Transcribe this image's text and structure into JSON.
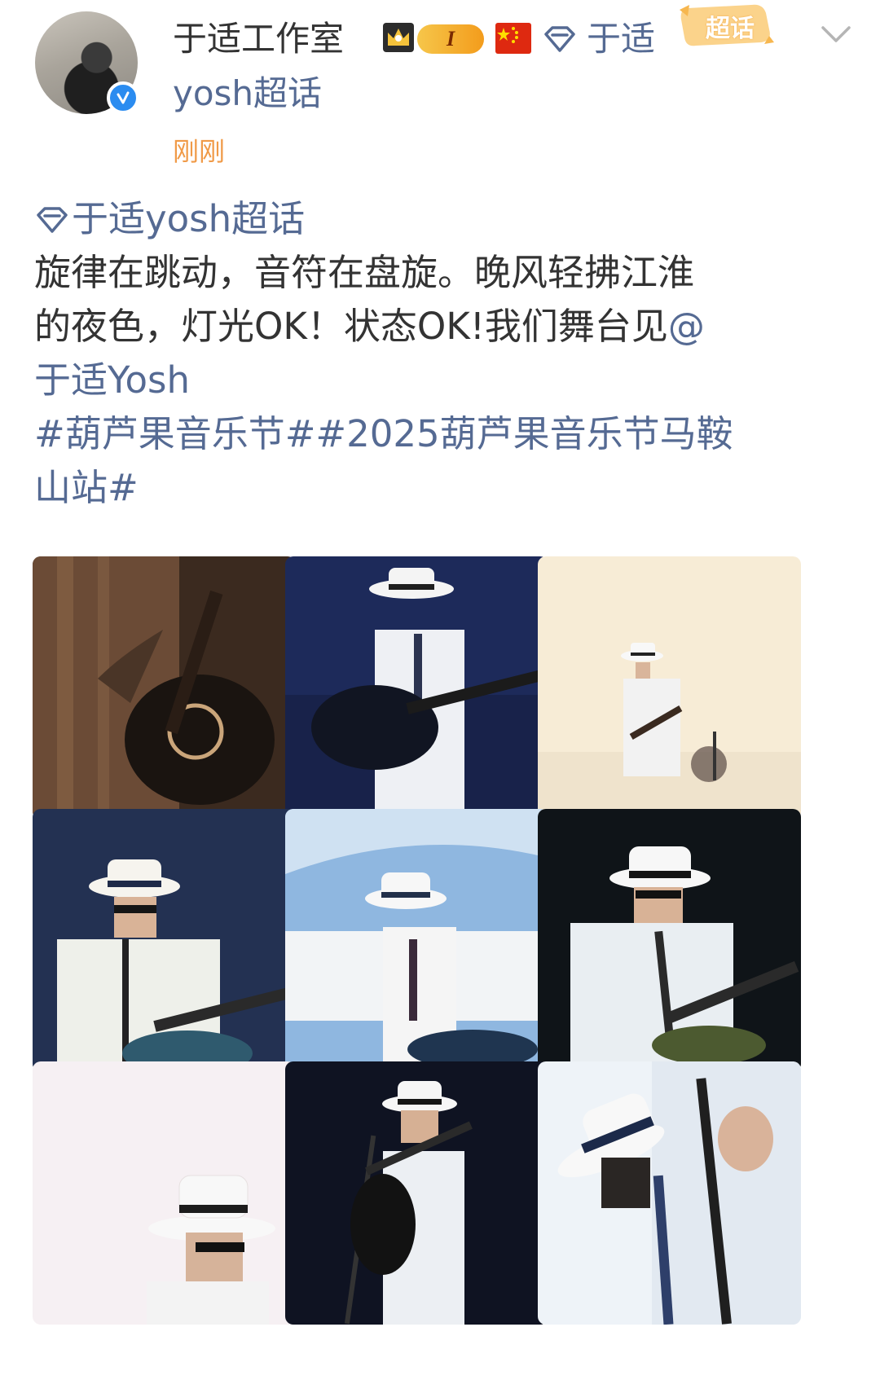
{
  "header": {
    "username": "于适工作室",
    "level": "I",
    "tag_link": "于适",
    "supertopic_badge": "超话",
    "sub_name": "yosh超话",
    "timestamp": "刚刚",
    "icons": [
      "crown-icon",
      "flag-icon",
      "supertopic-icon",
      "chevron-down-icon",
      "verified-icon"
    ]
  },
  "post": {
    "topic_link": "于适yosh超话",
    "lines": [
      "旋律在跳动，音符在盘旋。晚风轻拂江淮",
      "的夜色，灯光OK！状态OK!我们舞台见"
    ],
    "mention_at": "@",
    "mention_name": "于适Yosh",
    "hashtag_1": "#葫芦果音乐节#",
    "hashtag_2_line1": "#2025葫芦果音乐节马鞍",
    "hashtag_2_line2": "山站#"
  },
  "images": {
    "count": 9,
    "tiles": [
      {
        "id": "photo-1",
        "bg": "#3a2a20"
      },
      {
        "id": "photo-2",
        "bg": "#1e2a55"
      },
      {
        "id": "photo-3",
        "bg": "#f6ead2"
      },
      {
        "id": "photo-4",
        "bg": "#233050"
      },
      {
        "id": "photo-5",
        "bg": "#7aa6d6"
      },
      {
        "id": "photo-6",
        "bg": "#101418"
      },
      {
        "id": "photo-7",
        "bg": "#f4eef0"
      },
      {
        "id": "photo-8",
        "bg": "#0e1220"
      },
      {
        "id": "photo-9",
        "bg": "#eef3f8"
      }
    ]
  },
  "colors": {
    "link": "#556a93",
    "timestamp": "#f09a47",
    "text": "#333333",
    "verified": "#2b8cf0"
  }
}
